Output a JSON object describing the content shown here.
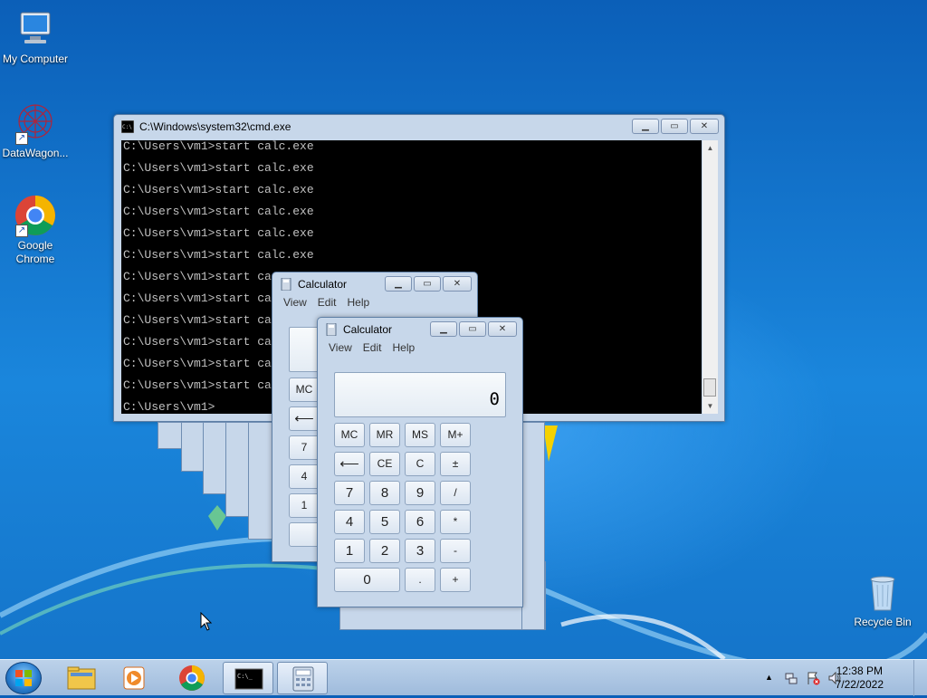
{
  "desktop": {
    "icons": [
      {
        "label": "My Computer"
      },
      {
        "label": "DataWagon..."
      },
      {
        "label": "Google Chrome"
      },
      {
        "label": "Recycle Bin"
      }
    ]
  },
  "cmd": {
    "title": "C:\\Windows\\system32\\cmd.exe",
    "lines": [
      "C:\\Users\\vm1>start calc.exe",
      "C:\\Users\\vm1>start calc.exe",
      "C:\\Users\\vm1>start calc.exe",
      "C:\\Users\\vm1>start calc.exe",
      "C:\\Users\\vm1>start calc.exe",
      "C:\\Users\\vm1>start calc.exe",
      "C:\\Users\\vm1>start ca",
      "C:\\Users\\vm1>start ca",
      "C:\\Users\\vm1>start ca",
      "C:\\Users\\vm1>start ca",
      "C:\\Users\\vm1>start ca",
      "C:\\Users\\vm1>start ca",
      "C:\\Users\\vm1>"
    ]
  },
  "calculator": {
    "title": "Calculator",
    "menu": [
      "View",
      "Edit",
      "Help"
    ],
    "display_value": "0",
    "keys": {
      "mc": "MC",
      "mr": "MR",
      "ms": "MS",
      "mplus": "M+",
      "back": "⟵",
      "ce": "CE",
      "c": "C",
      "pm": "±",
      "k7": "7",
      "k8": "8",
      "k9": "9",
      "div": "/",
      "k4": "4",
      "k5": "5",
      "k6": "6",
      "mul": "*",
      "k1": "1",
      "k2": "2",
      "k3": "3",
      "sub": "-",
      "k0": "0",
      "dot": ".",
      "add": "+"
    },
    "back_calc_visible_keys": {
      "mc": "MC",
      "back": "⟵",
      "k7": "7",
      "k4": "4",
      "k1": "1"
    }
  },
  "taskbar": {
    "clock_time": "12:38 PM",
    "clock_date": "7/22/2022"
  },
  "colors": {
    "desktop": "#1473c8",
    "console_bg": "#000000",
    "console_text": "#c0c0c0"
  }
}
